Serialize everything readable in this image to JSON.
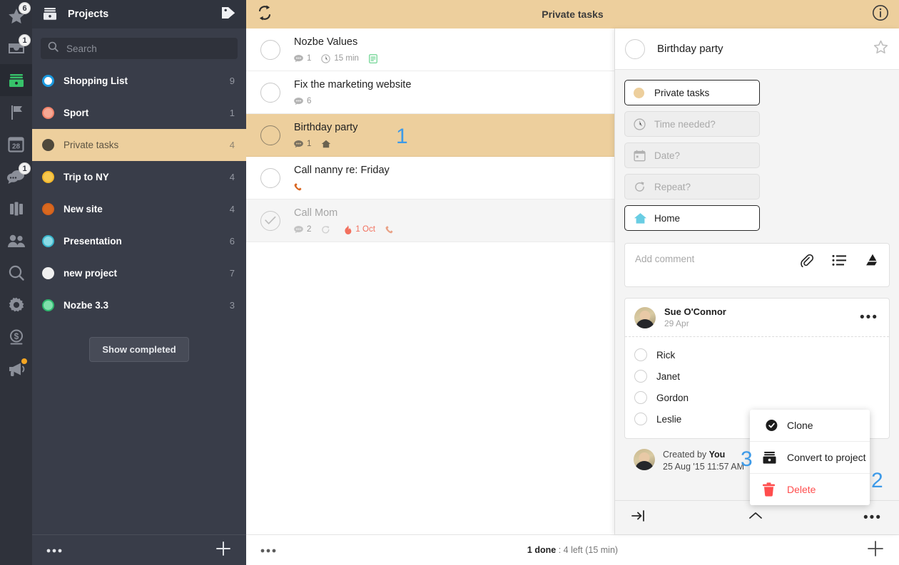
{
  "colors": {
    "accent_tan": "#edcf9d",
    "sidebar_bg": "#393d49",
    "rail_bg": "#2f323b",
    "annotation_blue": "#3d9ae8",
    "danger_red": "#ff4d4d",
    "overdue_red": "#f2705e"
  },
  "rail": {
    "items": [
      {
        "name": "star-icon",
        "icon": "star",
        "badge": "6",
        "active": false
      },
      {
        "name": "inbox-icon",
        "icon": "inbox",
        "badge": "1",
        "active": false
      },
      {
        "name": "projects-icon",
        "icon": "projects",
        "badge": "",
        "active": true
      },
      {
        "name": "flag-icon",
        "icon": "flag",
        "badge": "",
        "active": false
      },
      {
        "name": "calendar-icon",
        "icon": "calendar",
        "badge": "",
        "day": "28",
        "active": false
      },
      {
        "name": "comments-icon",
        "icon": "comments",
        "badge": "1",
        "active": false
      },
      {
        "name": "briefcase-icon",
        "icon": "briefcase",
        "badge": "",
        "active": false
      },
      {
        "name": "team-icon",
        "icon": "team",
        "badge": "",
        "active": false
      },
      {
        "name": "search-icon",
        "icon": "search",
        "badge": "",
        "active": false
      },
      {
        "name": "settings-icon",
        "icon": "gear",
        "badge": "",
        "active": false
      },
      {
        "name": "billing-icon",
        "icon": "dollar",
        "badge": "",
        "active": false
      },
      {
        "name": "announcements-icon",
        "icon": "megaphone",
        "badge": "",
        "dot": true,
        "active": false
      }
    ]
  },
  "sidebar": {
    "title": "Projects",
    "tag_icon": "tag-icon",
    "header_icon": "projects-icon",
    "search": {
      "placeholder": "Search",
      "value": ""
    },
    "projects": [
      {
        "name": "Shopping List",
        "count": "9",
        "color": "#1b9ae0",
        "filled": false,
        "selected": false
      },
      {
        "name": "Sport",
        "count": "1",
        "color": "#f2836b",
        "filled": false,
        "selected": false
      },
      {
        "name": "Private tasks",
        "count": "4",
        "color": "#4e483c",
        "filled": true,
        "selected": true
      },
      {
        "name": "Trip to NY",
        "count": "4",
        "color": "#f3b72b",
        "filled": false,
        "selected": false
      },
      {
        "name": "New site",
        "count": "4",
        "color": "#d4601c",
        "filled": false,
        "selected": false
      },
      {
        "name": "Presentation",
        "count": "6",
        "color": "#5fc8d8",
        "filled": false,
        "selected": false
      },
      {
        "name": "new project",
        "count": "7",
        "color": "#f0f0f0",
        "filled": true,
        "selected": false
      },
      {
        "name": "Nozbe 3.3",
        "count": "3",
        "color": "#56cf8f",
        "filled": false,
        "selected": false
      }
    ],
    "show_completed_label": "Show completed",
    "footer": {
      "more_label": "•••",
      "add_label": "+"
    }
  },
  "topbar": {
    "title": "Private tasks",
    "sync_icon": "sync-icon",
    "info_icon": "info-icon"
  },
  "tasks": {
    "show_completed_label": "Show completed",
    "items": [
      {
        "name": "Nozbe Values",
        "selected": false,
        "done": false,
        "meta": [
          {
            "icon": "comment-icon",
            "text": "1"
          },
          {
            "icon": "clock-icon",
            "text": "15 min"
          },
          {
            "icon": "note-icon",
            "text": ""
          }
        ]
      },
      {
        "name": "Fix the marketing website",
        "selected": false,
        "done": false,
        "meta": [
          {
            "icon": "comment-icon",
            "text": "6"
          }
        ]
      },
      {
        "name": "Birthday party",
        "selected": true,
        "done": false,
        "annotation": "1",
        "meta": [
          {
            "icon": "comment-icon",
            "text": "1"
          },
          {
            "icon": "home-icon",
            "text": ""
          }
        ]
      },
      {
        "name": "Call nanny re: Friday",
        "selected": false,
        "done": false,
        "meta": [
          {
            "icon": "phone-icon",
            "text": ""
          }
        ]
      },
      {
        "name": "Call Mom",
        "selected": false,
        "done": true,
        "meta": [
          {
            "icon": "comment-icon",
            "text": "2"
          },
          {
            "icon": "repeat-icon",
            "text": ""
          },
          {
            "icon": "fire-icon",
            "text": "1 Oct",
            "red": true
          },
          {
            "icon": "phone-icon",
            "text": ""
          }
        ]
      }
    ]
  },
  "status_bar": {
    "done_count": "1 done",
    "separator": ":",
    "left_text": "4 left (15 min)",
    "more_label": "•••",
    "add_label": "+"
  },
  "detail": {
    "title": "Birthday party",
    "star_icon": "star-outline-icon",
    "checkbox_icon": "task-checkbox-icon",
    "attributes": [
      {
        "label": "Private tasks",
        "icon": "project-dot-icon",
        "state": "set"
      },
      {
        "label": "Time needed?",
        "icon": "clock-icon",
        "state": "empty"
      },
      {
        "label": "Date?",
        "icon": "calendar-icon",
        "state": "empty"
      },
      {
        "label": "Repeat?",
        "icon": "repeat-icon",
        "state": "empty"
      },
      {
        "label": "Home",
        "icon": "home-icon",
        "state": "set"
      }
    ],
    "comment_input": {
      "placeholder": "Add comment",
      "icons": [
        "attach-icon",
        "checklist-icon",
        "google-drive-icon"
      ]
    },
    "comment": {
      "author": "Sue O'Connor",
      "date": "29 Apr",
      "more_label": "•••",
      "checklist": [
        {
          "label": "Rick",
          "checked": false
        },
        {
          "label": "Janet",
          "checked": false
        },
        {
          "label": "Gordon",
          "checked": false
        },
        {
          "label": "Leslie",
          "checked": false
        }
      ]
    },
    "created": {
      "prefix": "Created by ",
      "author": "You",
      "timestamp": "25 Aug '15 11:57 AM"
    },
    "footer": {
      "indent_icon": "indent-icon",
      "collapse_icon": "chevron-up-icon",
      "more_label": "•••",
      "annotation": "2"
    }
  },
  "context_menu": {
    "annotation": "3",
    "items": [
      {
        "label": "Clone",
        "icon": "clone-icon",
        "danger": false
      },
      {
        "label": "Convert to project",
        "icon": "convert-project-icon",
        "danger": false
      },
      {
        "label": "Delete",
        "icon": "trash-icon",
        "danger": true
      }
    ]
  }
}
